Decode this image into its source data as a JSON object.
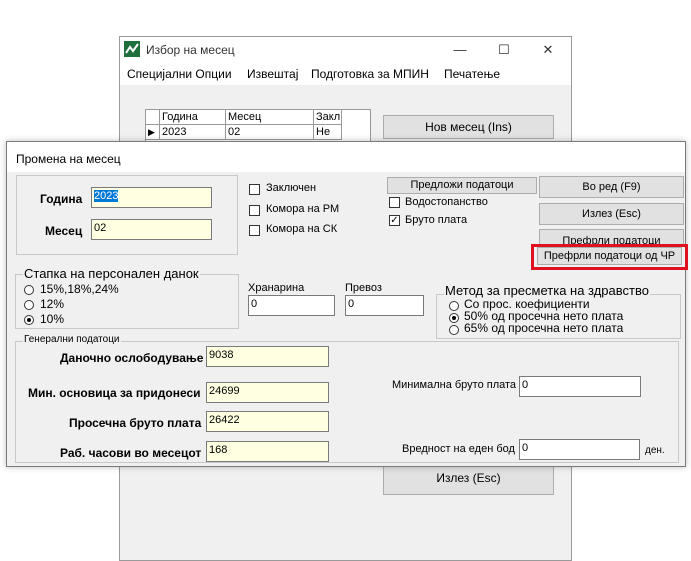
{
  "bg_window": {
    "title": "Избор на месец",
    "minimize": "—",
    "maximize": "☐",
    "close": "✕",
    "menu": [
      "Специјални Опции",
      "Извештај",
      "Подготовка за МПИН",
      "Печатење"
    ],
    "grid": {
      "headers": [
        "Година",
        "Месец",
        "Закл"
      ],
      "row": [
        "2023",
        "02",
        "Не"
      ]
    },
    "new_month_button": "Нов месец (Ins)",
    "exit_button": "Излез (Esc)"
  },
  "dialog": {
    "title": "Промена на месец",
    "year_label": "Година",
    "year_value": "2023",
    "month_label": "Месец",
    "month_value": "02",
    "checks": {
      "locked": "Заключен",
      "chamber_rm": "Комора на РМ",
      "chamber_sk": "Комора на СК",
      "water": "Водостопанство",
      "gross": "Бруто плата"
    },
    "suggest_button": "Предложи податоци",
    "ok_button": "Во ред (F9)",
    "exit_button": "Излез (Esc)",
    "transfer_button": "Префрли податоци",
    "transfer_cr_button": "Префрли податоци од ЧР",
    "tax_group": {
      "title": "Стапка на персонален данок",
      "options": [
        "15%,18%,24%",
        "12%",
        "10%"
      ]
    },
    "meal_label": "Хранарина",
    "meal_value": "0",
    "transport_label": "Превоз",
    "transport_value": "0",
    "health_group": {
      "title": "Метод за пресметка на здравство",
      "options": [
        "Со прос. коефициенти",
        "50% од просечна нето плата",
        "65% од просечна нето плата"
      ]
    },
    "general_group": {
      "title": "Генерални податоци",
      "tax_relief_label": "Даночно ослободување",
      "tax_relief_value": "9038",
      "min_base_label": "Мин. основица за придонеси",
      "min_base_value": "24699",
      "avg_gross_label": "Просечна бруто плата",
      "avg_gross_value": "26422",
      "hours_label": "Раб. часови во месецот",
      "hours_value": "168",
      "min_gross_label": "Минимална бруто плата",
      "min_gross_value": "0",
      "point_label": "Вредност на еден бод",
      "point_value": "0",
      "point_unit": "ден."
    }
  },
  "colors": {
    "highlight": "#e0101e",
    "field_bg": "#ffffe1"
  }
}
